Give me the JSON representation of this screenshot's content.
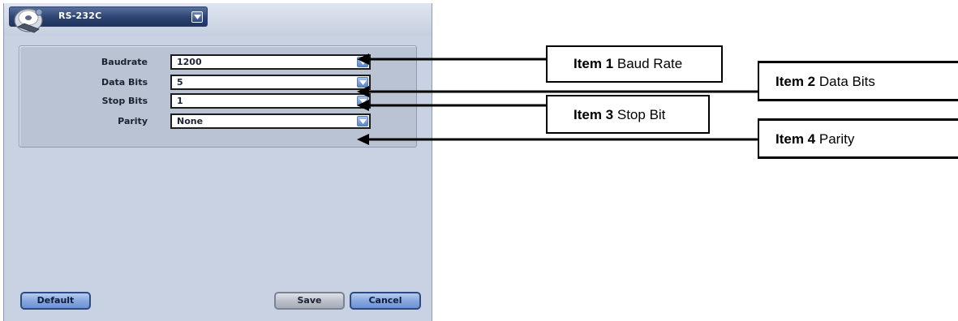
{
  "window": {
    "title": "RS-232C",
    "icon": "serial-port-icon"
  },
  "settings": [
    {
      "label": "Baudrate",
      "value": "1200"
    },
    {
      "label": "Data Bits",
      "value": "5"
    },
    {
      "label": "Stop Bits",
      "value": "1"
    },
    {
      "label": "Parity",
      "value": "None"
    }
  ],
  "buttons": {
    "default": "Default",
    "save": "Save",
    "cancel": "Cancel"
  },
  "callouts": [
    {
      "item": "Item 1",
      "desc": "Baud Rate"
    },
    {
      "item": "Item 2",
      "desc": "Data Bits"
    },
    {
      "item": "Item 3",
      "desc": "Stop Bit"
    },
    {
      "item": "Item 4",
      "desc": "Parity"
    }
  ],
  "colors": {
    "dialog_bg": "#c8d2e2",
    "panel_bg": "#bac3d4",
    "titlebar_tab": "#2c4372",
    "primary_button": "#87a8df",
    "secondary_button": "#b9bec8"
  }
}
